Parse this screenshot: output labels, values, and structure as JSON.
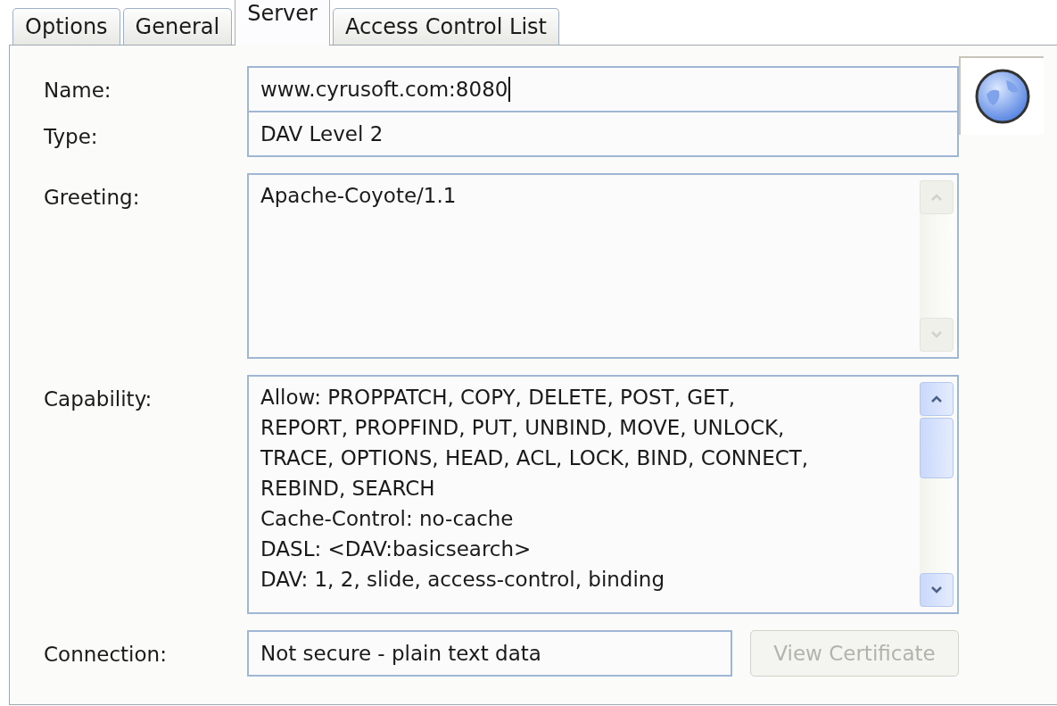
{
  "tabs": [
    {
      "label": "Options",
      "selected": false
    },
    {
      "label": "General",
      "selected": false
    },
    {
      "label": "Server",
      "selected": true
    },
    {
      "label": "Access Control List",
      "selected": false
    }
  ],
  "name": {
    "label": "Name:",
    "value": "www.cyrusoft.com:8080",
    "focused": true
  },
  "type": {
    "label": "Type:",
    "value": "DAV Level 2"
  },
  "greeting": {
    "label": "Greeting:",
    "lines": [
      "Apache-Coyote/1.1"
    ],
    "scrollable": false
  },
  "capability": {
    "label": "Capability:",
    "lines": [
      "Allow: PROPPATCH, COPY, DELETE, POST, GET,",
      "REPORT, PROPFIND, PUT, UNBIND, MOVE, UNLOCK,",
      "TRACE, OPTIONS, HEAD, ACL, LOCK, BIND, CONNECT,",
      "REBIND, SEARCH",
      "Cache-Control: no-cache",
      "DASL: <DAV:basicsearch>",
      "DAV: 1, 2, slide, access-control, binding"
    ],
    "scrollable": true
  },
  "connection": {
    "label": "Connection:",
    "value": "Not secure - plain text data"
  },
  "view_certificate_button": {
    "label": "View Certificate",
    "disabled": true
  }
}
